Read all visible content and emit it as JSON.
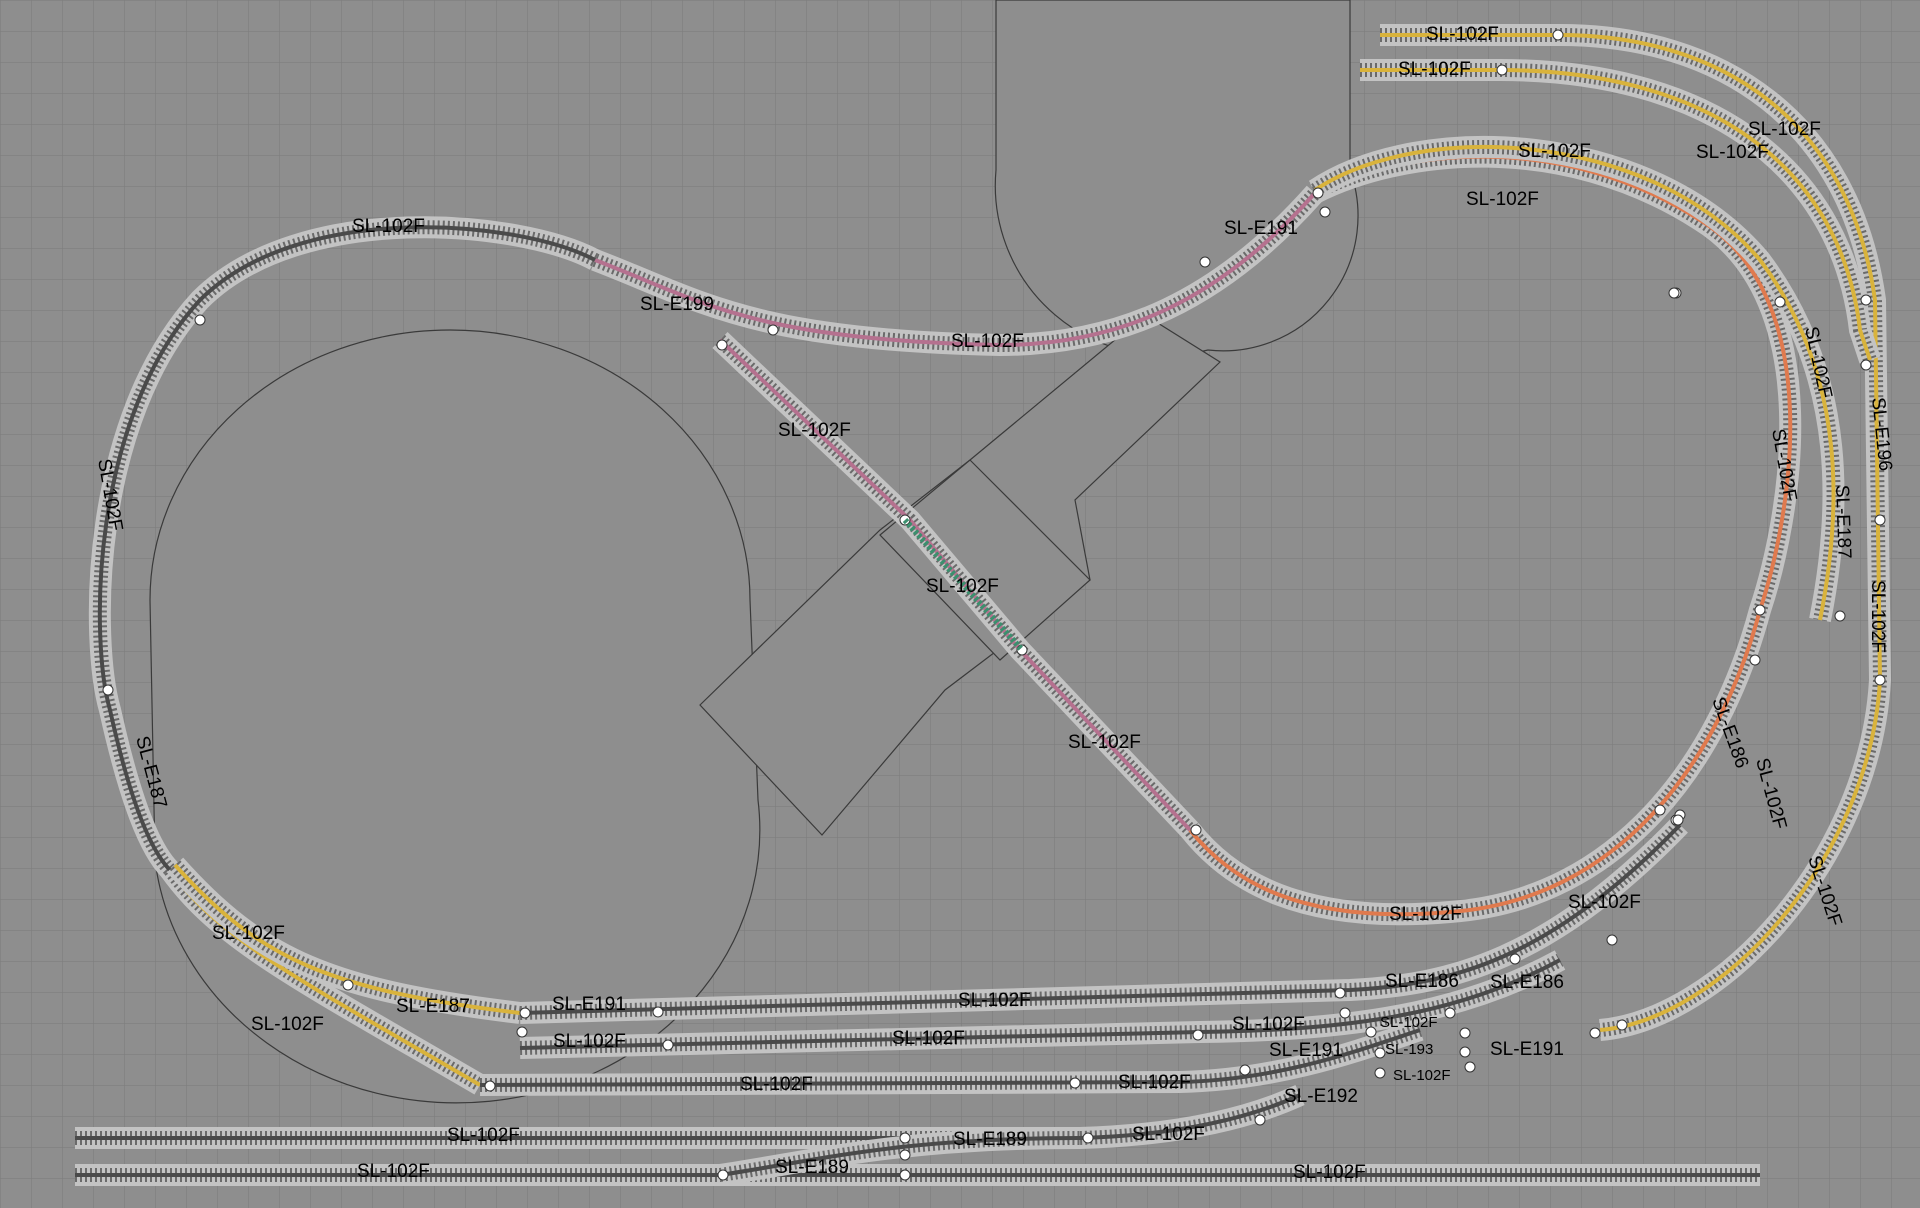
{
  "colors": {
    "background": "#8e8e8e",
    "grid": "#7a7a7a",
    "ballast": "#c3c3c3",
    "track_yellow": "#d9b33c",
    "track_pink": "#b5718f",
    "track_orange": "#e07a4e",
    "track_dark": "#4a4a4a",
    "bridge_green": "#3c8f6e"
  },
  "labels": {
    "top_1": "SL-102F",
    "top_2": "SL-102F",
    "right_outer_1": "SL-102F",
    "right_outer_2": "SL-102F",
    "upper_curve": "SL-102F",
    "upper_inner": "SL-102F",
    "e191_upper": "SL-E191",
    "left_top": "SL-102F",
    "e199": "SL-E199",
    "pink_mid": "SL-102F",
    "diag_upper": "SL-102F",
    "bridge": "SL-102F",
    "diag_lower": "SL-102F",
    "left_side": "SL-102F",
    "left_e187": "SL-E187",
    "right_vert_1": "SL-102F",
    "right_vert_2": "SL-102F",
    "right_e187": "SL-E187",
    "right_e196": "SL-E196",
    "right_vert_3": "SL-102F",
    "right_vert_4": "SL-102F",
    "right_vert_5": "SL-102F",
    "right_vert_6": "SL-102F",
    "e186_right": "SL-E186",
    "bottom_orange": "SL-102F",
    "right_lower": "SL-102F",
    "left_lower_1": "SL-102F",
    "left_lower_2": "SL-102F",
    "yard_e187": "SL-E187",
    "yard_e191_a": "SL-E191",
    "yard_1": "SL-102F",
    "yard_e186_a": "SL-E186",
    "yard_e186_b": "SL-E186",
    "yard_2": "SL-102F",
    "yard_3": "SL-102F",
    "yard_4": "SL-102F",
    "yard_small_1": "SL-102F",
    "yard_e191_b": "SL-E191",
    "yard_e193": "SL-193",
    "yard_e191_c": "SL-E191",
    "yard_5": "SL-102F",
    "yard_6": "SL-102F",
    "yard_small_2": "SL-102F",
    "yard_e192": "SL-E192",
    "bottom_1": "SL-102F",
    "bottom_e189_a": "SL-E189",
    "bottom_2": "SL-102F",
    "bottom_3": "SL-102F",
    "bottom_e189_b": "SL-E189",
    "bottom_4": "SL-102F"
  }
}
